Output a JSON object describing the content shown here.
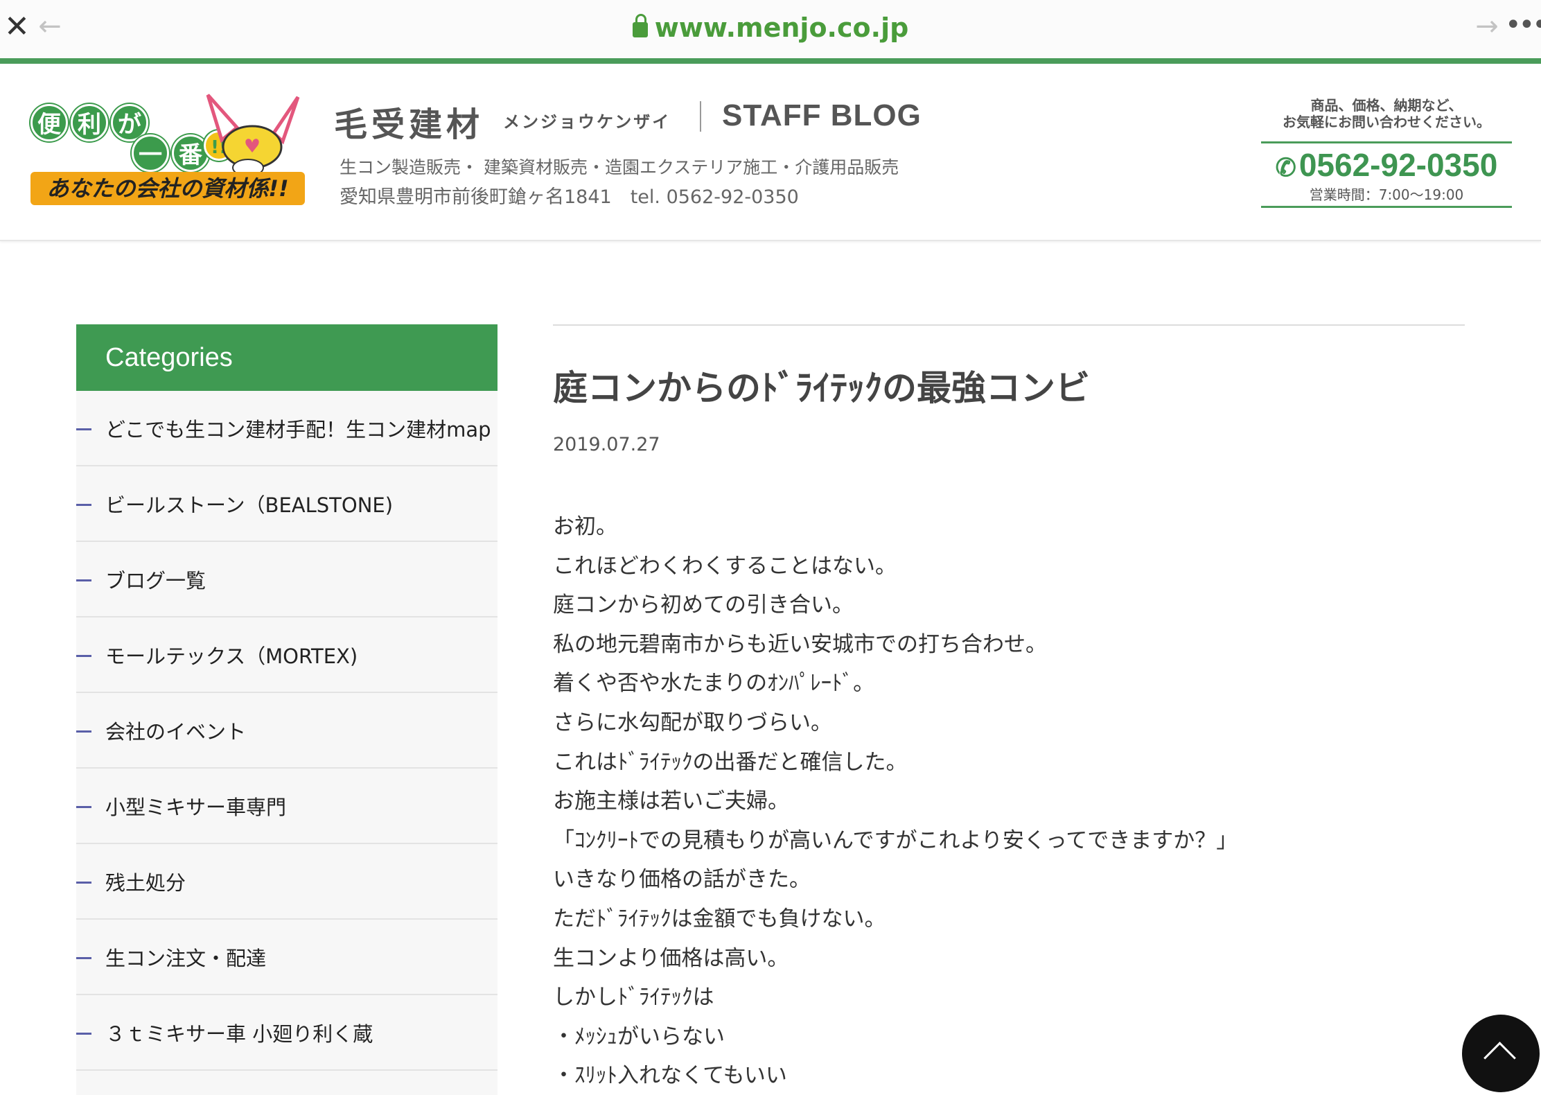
{
  "browser": {
    "close_icon": "close-icon",
    "back_icon": "arrow-left-icon",
    "forward_icon": "arrow-right-icon",
    "more_icon": "more-horizontal-icon",
    "url": "www.menjo.co.jp",
    "accent": "#4a9c3b"
  },
  "header": {
    "logo": {
      "bubbles": [
        "便",
        "利",
        "が",
        "一",
        "番",
        "!!"
      ],
      "tagline": "あなたの会社の資材係!!"
    },
    "brand_name": "毛受建材",
    "brand_kana": "メンジョウケンザイ",
    "brand_blog": "STAFF BLOG",
    "services": "生コン製造販売・ 建築資材販売・造園エクステリア施工・介護用品販売",
    "address": "愛知県豊明市前後町鎗ヶ名1841　tel. 0562-92-0350",
    "contact_note_line1": "商品、価格、納期など、",
    "contact_note_line2": "お気軽にお問い合わせください。",
    "phone": "0562-92-0350",
    "hours": "営業時間：7:00〜19:00",
    "accent": "#3e9551"
  },
  "sidebar": {
    "title": "Categories",
    "items": [
      {
        "label": "どこでも生コン建材手配！生コン建材map"
      },
      {
        "label": "ビールストーン（BEALSTONE)"
      },
      {
        "label": "ブログ一覧"
      },
      {
        "label": "モールテックス（MORTEX)"
      },
      {
        "label": "会社のイベント"
      },
      {
        "label": "小型ミキサー車専門"
      },
      {
        "label": "残土処分"
      },
      {
        "label": "生コン注文・配達"
      },
      {
        "label": "３ｔミキサー車 小廻り利く蔵"
      }
    ],
    "header_color": "#3f9a52"
  },
  "article": {
    "title": "庭コンからのﾄﾞﾗｲﾃｯｸの最強コンビ",
    "date": "2019.07.27",
    "lines": [
      "お初。",
      "これほどわくわくすることはない。",
      "庭コンから初めての引き合い。",
      "私の地元碧南市からも近い安城市での打ち合わせ。",
      "着くや否や水たまりのｵﾝﾊﾟﾚｰﾄﾞ。",
      "さらに水勾配が取りづらい。",
      "これはﾄﾞﾗｲﾃｯｸの出番だと確信した。",
      "お施主様は若いご夫婦。",
      "「ｺﾝｸﾘｰﾄでの見積もりが高いんですがこれより安くってできますか？」",
      "いきなり価格の話がきた。",
      "ただﾄﾞﾗｲﾃｯｸは金額でも負けない。",
      "生コンより価格は高い。",
      "しかしﾄﾞﾗｲﾃｯｸは",
      "・ﾒｯｼｭがいらない",
      "・ｽﾘｯﾄ入れなくてもいい"
    ]
  },
  "back_to_top_icon": "chevron-up-icon"
}
